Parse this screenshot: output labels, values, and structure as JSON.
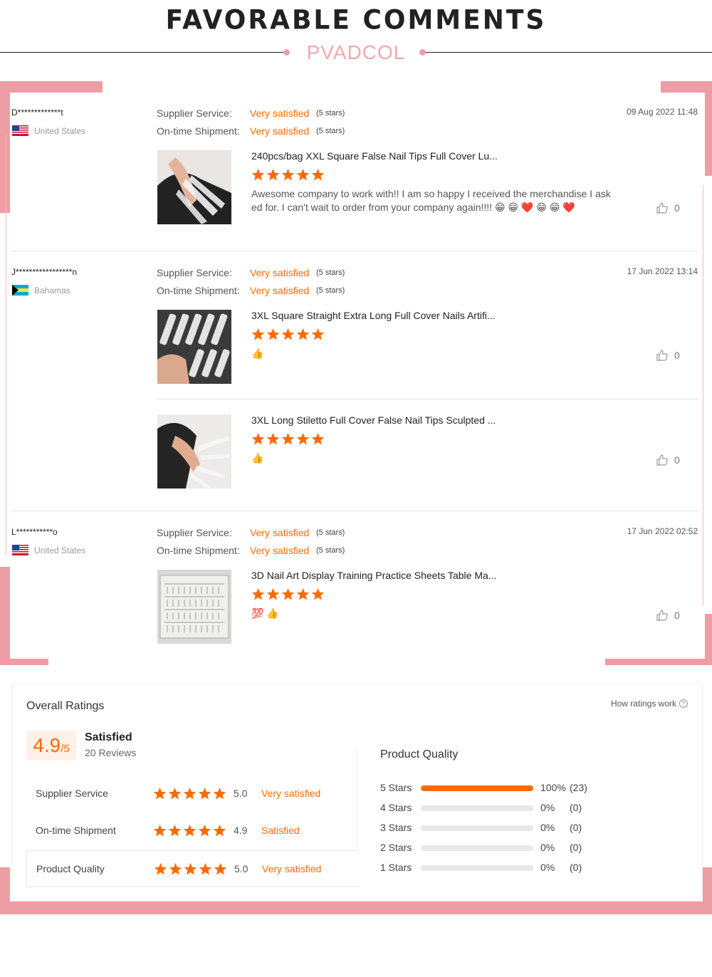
{
  "header": {
    "title": "FAVORABLE COMMENTS",
    "brand": "PVADCOL"
  },
  "labels": {
    "supplier": "Supplier Service:",
    "shipment": "On-time Shipment:",
    "stars_note": "(5 stars)",
    "value": "Very satisfied"
  },
  "colors": {
    "accent": "#ff6a00",
    "frame_pink": "#ed9ea4"
  },
  "reviews": [
    {
      "user": "D*************t",
      "country": "United States",
      "flag": "us-flag",
      "date": "09 Aug 2022 11:48",
      "items": [
        {
          "title": "240pcs/bag XXL Square False Nail Tips Full Cover Lu...",
          "rating": 5,
          "comment": "Awesome company to work with!! I am so happy I received the merchandise I ask ed for. I can't wait to order from your company again!!!! 😁 😁 ❤️ 😁 😁 ❤️",
          "likes": "0"
        }
      ]
    },
    {
      "user": "J*****************n",
      "country": "Bahamas",
      "flag": "bahamas-flag",
      "date": "17 Jun 2022 13:14",
      "items": [
        {
          "title": "3XL Square Straight Extra Long Full Cover Nails Artifi...",
          "rating": 5,
          "comment": "👍",
          "likes": "0"
        },
        {
          "title": "3XL Long Stiletto Full Cover False Nail Tips Sculpted ...",
          "rating": 5,
          "comment": "👍",
          "likes": "0"
        }
      ]
    },
    {
      "user": "L***********o",
      "country": "United States",
      "flag": "us-flag",
      "date": "17 Jun 2022 02:52",
      "items": [
        {
          "title": "3D Nail Art Display Training Practice Sheets Table Ma...",
          "rating": 5,
          "comment": "💯 👍",
          "likes": "0"
        }
      ]
    }
  ],
  "ratings": {
    "title": "Overall Ratings",
    "how": "How ratings work",
    "score": "4.9",
    "score_den": "/5",
    "summary": "Satisfied",
    "count": "20 Reviews",
    "rows": [
      {
        "name": "Supplier Service",
        "stars": 5,
        "value": "5.0",
        "text": "Very satisfied"
      },
      {
        "name": "On-time Shipment",
        "stars": 5,
        "value": "4.9",
        "text": "Satisfied"
      },
      {
        "name": "Product Quality",
        "stars": 5,
        "value": "5.0",
        "text": "Very satisfied"
      }
    ],
    "breakdown_title": "Product Quality",
    "breakdown": [
      {
        "label": "5  Stars",
        "fraction": 1.0,
        "pct": "100%",
        "count": "(23)"
      },
      {
        "label": "4  Stars",
        "fraction": 0,
        "pct": "0%",
        "count": "(0)"
      },
      {
        "label": "3  Stars",
        "fraction": 0,
        "pct": "0%",
        "count": "(0)"
      },
      {
        "label": "2  Stars",
        "fraction": 0,
        "pct": "0%",
        "count": "(0)"
      },
      {
        "label": "1  Stars",
        "fraction": 0,
        "pct": "0%",
        "count": "(0)"
      }
    ]
  }
}
